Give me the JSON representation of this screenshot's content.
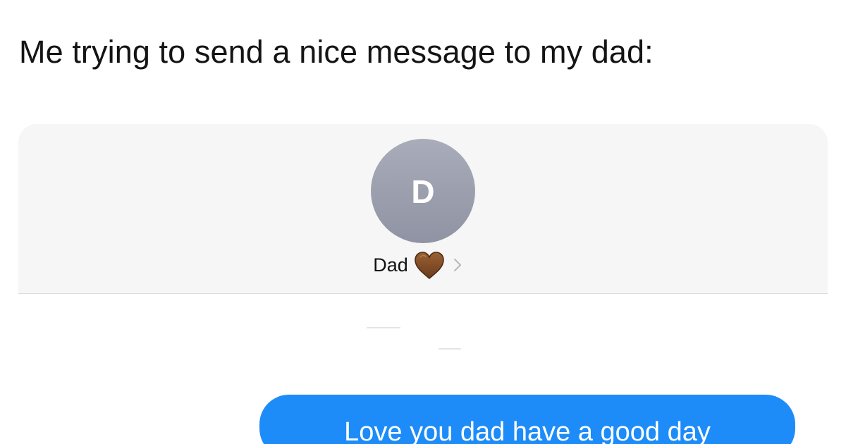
{
  "caption": "Me trying to send a nice message to my dad:",
  "conversation": {
    "avatar_initial": "D",
    "contact_name": "Dad",
    "contact_emoji": "brown-heart-icon",
    "chevron": "chevron-right-icon",
    "message": {
      "text": "Love you dad have a good day",
      "sender": "me"
    }
  },
  "colors": {
    "header_background": "#f6f6f6",
    "avatar": "#9a9eac",
    "heart": "#7b4a26",
    "bubble": "#1d8cf8",
    "bubble_text": "#ffffff",
    "caption_text": "#141414"
  }
}
